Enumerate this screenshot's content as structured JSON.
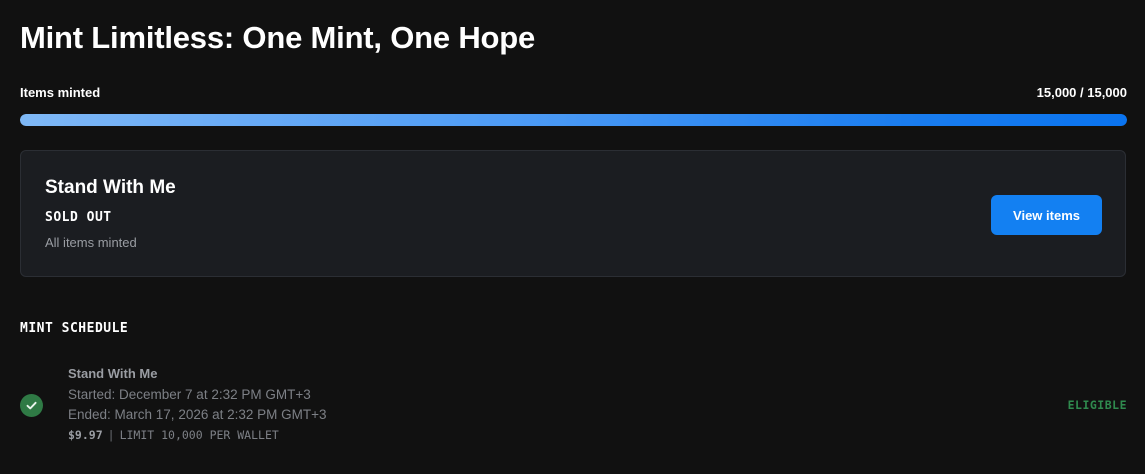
{
  "page": {
    "title": "Mint Limitless: One Mint, One Hope"
  },
  "progress": {
    "label": "Items minted",
    "count_text": "15,000 / 15,000",
    "fraction": 1.0
  },
  "current_stage": {
    "name": "Stand With Me",
    "status": "SOLD OUT",
    "subtext": "All items minted",
    "button_label": "View items"
  },
  "schedule": {
    "heading": "MINT SCHEDULE",
    "rows": [
      {
        "name": "Stand With Me",
        "started": "Started: December 7 at 2:32 PM GMT+3",
        "ended": "Ended: March 17, 2026 at 2:32 PM GMT+3",
        "price": "$9.97",
        "separator": "|",
        "limit": "LIMIT 10,000 PER WALLET",
        "badge": "ELIGIBLE",
        "icon": "check-circle-icon"
      }
    ]
  },
  "colors": {
    "background": "#111111",
    "accent": "#1380f2",
    "eligible": "#2f8a4e",
    "check": "#2f7a45"
  }
}
